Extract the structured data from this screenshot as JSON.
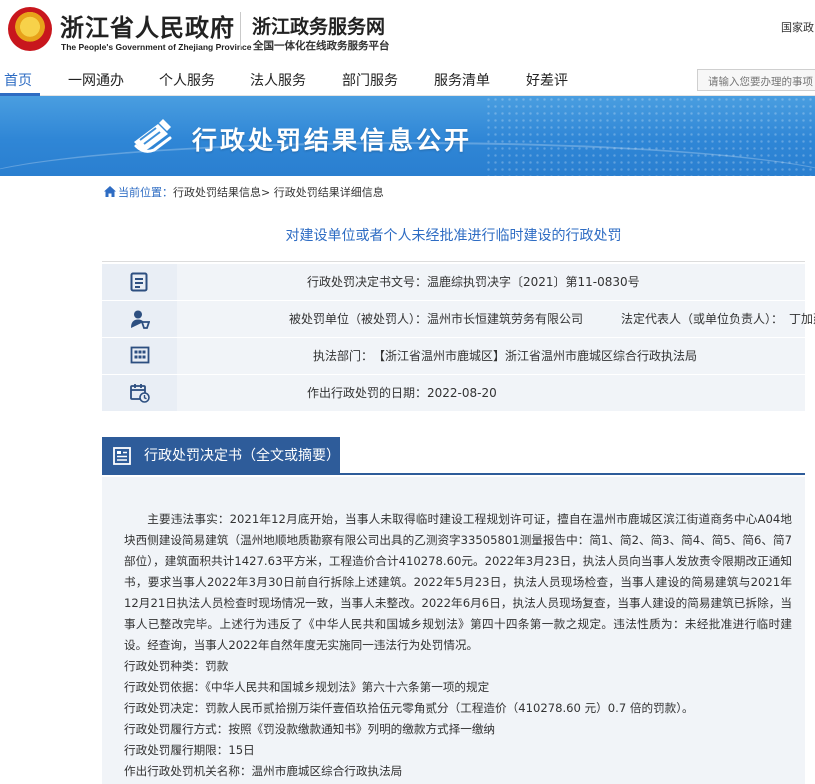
{
  "header": {
    "gov_name": "浙江省人民政府",
    "gov_name_en": "The People's Government of Zhejiang Province",
    "site_name": "浙江政务服务网",
    "site_subtitle": "全国一体化在线政务服务平台",
    "top_link": "国家政"
  },
  "nav": {
    "items": [
      "首页",
      "一网通办",
      "个人服务",
      "法人服务",
      "部门服务",
      "服务清单",
      "好差评"
    ],
    "active": "首页"
  },
  "search": {
    "placeholder": "请输入您要办理的事项"
  },
  "banner": {
    "title": "行政处罚结果信息公开"
  },
  "breadcrumb": {
    "current_label": "当前位置：",
    "items": [
      "行政处罚结果信息",
      "行政处罚结果详细信息"
    ],
    "separator": ">"
  },
  "detail": {
    "title": "对建设单位或者个人未经批准进行临时建设的行政处罚",
    "rows": [
      {
        "icon": "document-icon",
        "label": "行政处罚决定书文号：",
        "value": "温鹿综执罚决字〔2021〕第11-0830号"
      },
      {
        "icon": "person-icon",
        "label": "被处罚单位（被处罚人）：",
        "value": "温州市长恒建筑劳务有限公司",
        "label2": "法定代表人（或单位负责人）：",
        "value2": "丁加建"
      },
      {
        "icon": "building-icon",
        "label": "执法部门：",
        "value": "【浙江省温州市鹿城区】浙江省温州市鹿城区综合行政执法局"
      },
      {
        "icon": "calendar-icon",
        "label": "作出行政处罚的日期：",
        "value": "2022-08-20"
      }
    ]
  },
  "section": {
    "title": "行政处罚决定书（全文或摘要）"
  },
  "content": {
    "main_facts": "主要违法事实：2021年12月底开始，当事人未取得临时建设工程规划许可证，擅自在温州市鹿城区滨江街道商务中心A04地块西侧建设简易建筑（温州地顺地质勘察有限公司出具的乙测资字33505801测量报告中：简1、简2、简3、简4、简5、简6、简7部位），建筑面积共计1427.63平方米，工程造价合计410278.60元。2022年3月23日，执法人员向当事人发放责令限期改正通知书，要求当事人2022年3月30日前自行拆除上述建筑。2022年5月23日，执法人员现场检查，当事人建设的简易建筑与2021年12月21日执法人员检查时现场情况一致，当事人未整改。2022年6月6日，执法人员现场复查，当事人建设的简易建筑已拆除，当事人已整改完毕。上述行为违反了《中华人民共和国城乡规划法》第四十四条第一款之规定。违法性质为：未经批准进行临时建设。经查询，当事人2022年自然年度无实施同一违法行为处罚情况。",
    "lines": [
      "行政处罚种类：罚款",
      "行政处罚依据：《中华人民共和国城乡规划法》第六十六条第一项的规定",
      "行政处罚决定：罚款人民币贰拾捌万柒仟壹佰玖拾伍元零角贰分（工程造价（410278.60 元）0.7 倍的罚款）。",
      "行政处罚履行方式：按照《罚没款缴款通知书》列明的缴款方式择一缴纳",
      "行政处罚履行期限：15日",
      "作出行政处罚机关名称：温州市鹿城区综合行政执法局"
    ]
  }
}
